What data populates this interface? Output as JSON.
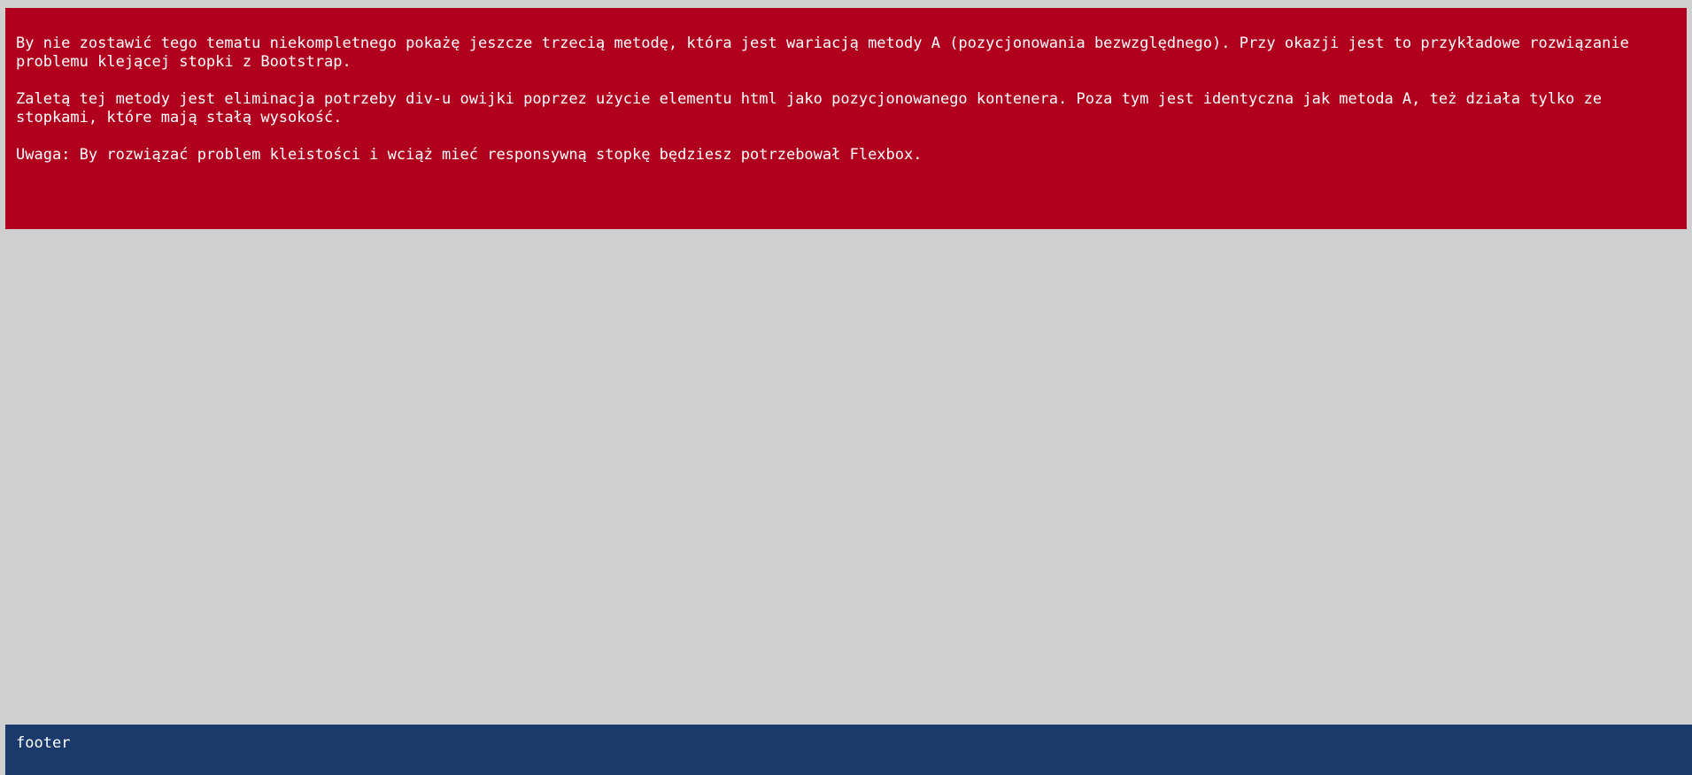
{
  "content": {
    "paragraphs": [
      "By nie zostawić tego tematu niekompletnego pokażę jeszcze trzecią metodę, która jest wariacją metody A (pozycjonowania bezwzględnego). Przy okazji jest to przykładowe rozwiązanie problemu klejącej stopki z Bootstrap.",
      "Zaletą tej metody jest eliminacja potrzeby div-u owijki poprzez użycie elementu html jako pozycjonowanego kontenera. Poza tym jest identyczna jak metoda A, też działa tylko ze stopkami, które mają stałą wysokość.",
      "Uwaga: By rozwiązać problem kleistości i wciąż mieć responsywną stopkę będziesz potrzebował Flexbox."
    ]
  },
  "footer": {
    "text": "footer"
  },
  "colors": {
    "content_background": "#b0001e",
    "page_background": "#cfcfcf",
    "footer_background": "#1a3a6b",
    "text": "#ffffff"
  }
}
